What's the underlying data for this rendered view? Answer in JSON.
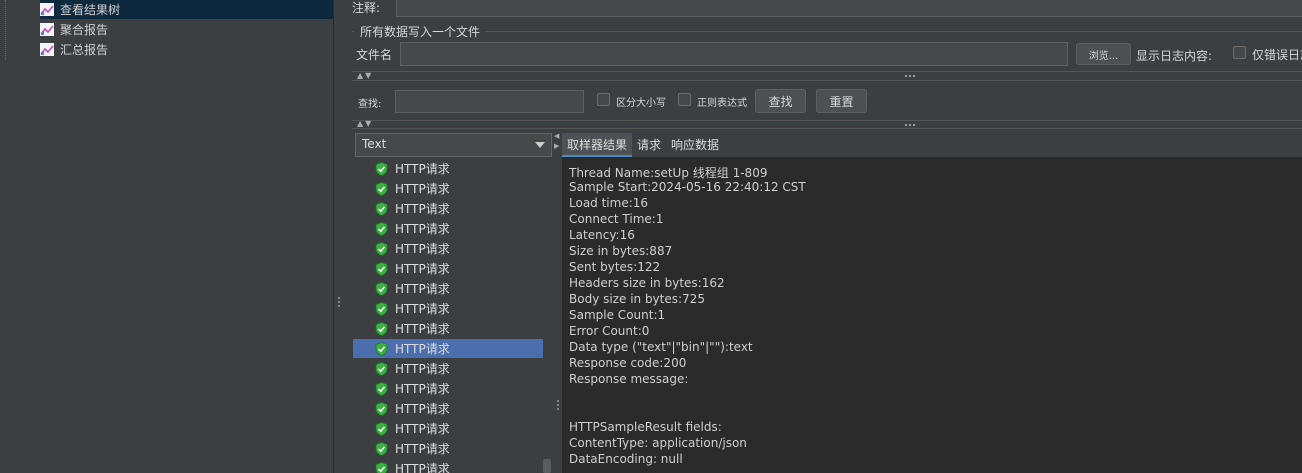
{
  "tree": {
    "items": [
      {
        "label": "查看结果树",
        "selected": true
      },
      {
        "label": "聚合报告",
        "selected": false
      },
      {
        "label": "汇总报告",
        "selected": false
      }
    ]
  },
  "top": {
    "comment_label": "注释:",
    "file_group_label": "所有数据写入一个文件",
    "filename_label": "文件名",
    "filename_value": "",
    "browse_label": "浏览...",
    "log_content_label": "显示日志内容:",
    "errors_only_label": "仅错误日志"
  },
  "search": {
    "label": "查找:",
    "value": "",
    "case_label": "区分大小写",
    "regex_label": "正则表达式",
    "find_button": "查找",
    "reset_button": "重置"
  },
  "renderer": {
    "selected": "Text"
  },
  "results": {
    "items": [
      "HTTP请求",
      "HTTP请求",
      "HTTP请求",
      "HTTP请求",
      "HTTP请求",
      "HTTP请求",
      "HTTP请求",
      "HTTP请求",
      "HTTP请求",
      "HTTP请求",
      "HTTP请求",
      "HTTP请求",
      "HTTP请求",
      "HTTP请求",
      "HTTP请求",
      "HTTP请求"
    ],
    "selected_index": 9
  },
  "detail": {
    "tabs": [
      "取样器结果",
      "请求",
      "响应数据"
    ],
    "lines": [
      "Thread Name:setUp 线程组 1-809",
      "Sample Start:2024-05-16 22:40:12 CST",
      "Load time:16",
      "Connect Time:1",
      "Latency:16",
      "Size in bytes:887",
      "Sent bytes:122",
      "Headers size in bytes:162",
      "Body size in bytes:725",
      "Sample Count:1",
      "Error Count:0",
      "Data type (\"text\"|\"bin\"|\"\"):text",
      "Response code:200",
      "Response message:",
      "",
      "",
      "HTTPSampleResult fields:",
      "ContentType: application/json",
      "DataEncoding: null"
    ]
  },
  "colors": {
    "background": "#3c3f41",
    "detail_bg": "#2b2b2b",
    "selection": "#4b6eaf",
    "success": "#3cb043"
  }
}
